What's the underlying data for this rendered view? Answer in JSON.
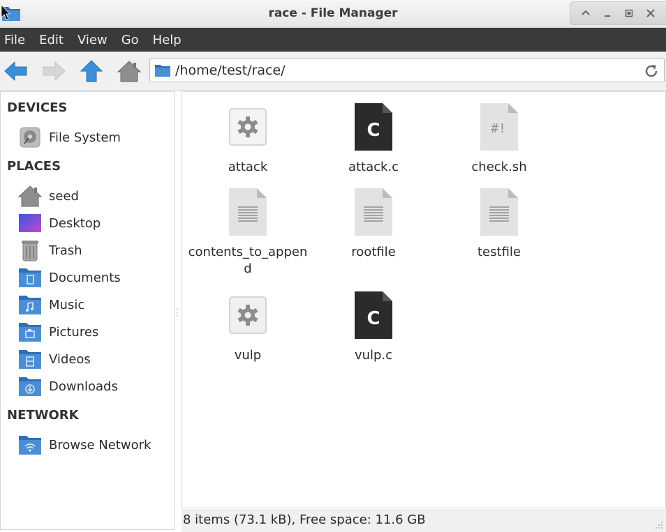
{
  "window": {
    "title": "race - File Manager"
  },
  "menu": [
    "File",
    "Edit",
    "View",
    "Go",
    "Help"
  ],
  "toolbar": {
    "location": "/home/test/race/",
    "buttons": [
      "back-arrow-icon",
      "forward-arrow-icon",
      "up-arrow-icon",
      "home-icon"
    ]
  },
  "sidebar": {
    "devices_title": "DEVICES",
    "devices": [
      {
        "label": "File System",
        "icon": "drive-icon"
      }
    ],
    "places_title": "PLACES",
    "places": [
      {
        "label": "seed",
        "icon": "home-folder-icon"
      },
      {
        "label": "Desktop",
        "icon": "desktop-icon"
      },
      {
        "label": "Trash",
        "icon": "trash-icon"
      },
      {
        "label": "Documents",
        "icon": "documents-folder-icon"
      },
      {
        "label": "Music",
        "icon": "music-folder-icon"
      },
      {
        "label": "Pictures",
        "icon": "pictures-folder-icon"
      },
      {
        "label": "Videos",
        "icon": "videos-folder-icon"
      },
      {
        "label": "Downloads",
        "icon": "downloads-folder-icon"
      }
    ],
    "network_title": "NETWORK",
    "network": [
      {
        "label": "Browse Network",
        "icon": "network-folder-icon"
      }
    ]
  },
  "files": [
    {
      "name": "attack",
      "icon": "executable-gear-icon"
    },
    {
      "name": "attack.c",
      "icon": "c-source-icon"
    },
    {
      "name": "check.sh",
      "icon": "shell-script-icon"
    },
    {
      "name": "contents_to_append",
      "icon": "text-file-icon"
    },
    {
      "name": "rootfile",
      "icon": "text-file-icon"
    },
    {
      "name": "testfile",
      "icon": "text-file-icon"
    },
    {
      "name": "vulp",
      "icon": "executable-gear-icon"
    },
    {
      "name": "vulp.c",
      "icon": "c-source-icon"
    }
  ],
  "status": "8 items (73.1 kB), Free space: 11.6 GB",
  "colors": {
    "menubar": "#3a3a3a",
    "folder_blue": "#4a86c8",
    "arrow_blue": "#3b8fd8"
  }
}
